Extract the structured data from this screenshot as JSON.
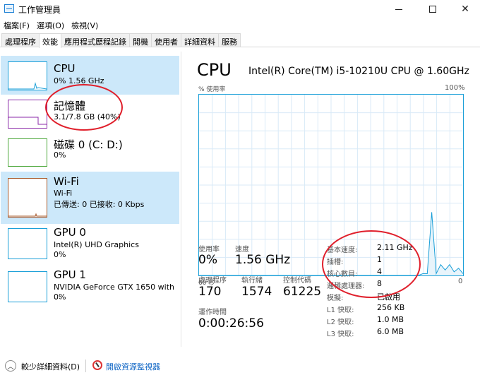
{
  "window": {
    "title": "工作管理員"
  },
  "menu": [
    "檔案(F)",
    "選項(O)",
    "檢視(V)"
  ],
  "tabs": [
    "處理程序",
    "效能",
    "應用程式歷程記錄",
    "開機",
    "使用者",
    "詳細資料",
    "服務"
  ],
  "active_tab_index": 1,
  "sidebar": {
    "items": [
      {
        "name": "CPU",
        "line1": "0% 1.56 GHz",
        "line2": "",
        "selected": true,
        "color": "#1a9fd8"
      },
      {
        "name": "記憶體",
        "line1": "3.1/7.8 GB (40%)",
        "line2": "",
        "selected": false,
        "color": "#8b2aa8"
      },
      {
        "name": "磁碟 0 (C: D:)",
        "line1": "0%",
        "line2": "",
        "selected": false,
        "color": "#4ca73a"
      },
      {
        "name": "Wi-Fi",
        "line1": "Wi-Fi",
        "line2": "已傳送: 0 已接收: 0 Kbps",
        "selected": true,
        "color": "#a6582a"
      },
      {
        "name": "GPU 0",
        "line1": "Intel(R) UHD Graphics",
        "line2": "0%",
        "selected": false,
        "color": "#1a9fd8"
      },
      {
        "name": "GPU 1",
        "line1": "NVIDIA GeForce GTX 1650 with ...",
        "line2": "0%",
        "selected": false,
        "color": "#1a9fd8"
      }
    ]
  },
  "main": {
    "title": "CPU",
    "model": "Intel(R) Core(TM) i5-10210U CPU @ 1.60GHz",
    "graph_label_left": "% 使用率",
    "graph_label_right": "100%",
    "graph_foot_left": "60 秒",
    "graph_foot_right": "0",
    "usage_percent_series": [
      0,
      0,
      0,
      0,
      0,
      0,
      0,
      0,
      0,
      0,
      0,
      0,
      0,
      0,
      0,
      0,
      0,
      0,
      0,
      0,
      0,
      0,
      0,
      0,
      0,
      0,
      0,
      0,
      0,
      0,
      0,
      0,
      0,
      0,
      0,
      0,
      0,
      0,
      0,
      0,
      0,
      0,
      0,
      0,
      0,
      0,
      0,
      0,
      0,
      0,
      1,
      1,
      35,
      1,
      6,
      3,
      6,
      2,
      4,
      1
    ],
    "stats": {
      "usage_label": "使用率",
      "usage_value": "0%",
      "speed_label": "速度",
      "speed_value": "1.56 GHz",
      "processes_label": "處理程序",
      "processes_value": "170",
      "threads_label": "執行緒",
      "threads_value": "1574",
      "handles_label": "控制代碼",
      "handles_value": "61225",
      "uptime_label": "運作時間",
      "uptime_value": "0:00:26:56"
    },
    "specs": [
      {
        "label": "基本速度:",
        "value": "2.11 GHz"
      },
      {
        "label": "插槽:",
        "value": "1"
      },
      {
        "label": "核心數目:",
        "value": "4"
      },
      {
        "label": "邏輯處理器:",
        "value": "8"
      },
      {
        "label": "模擬:",
        "value": "已啟用"
      },
      {
        "label": "L1 快取:",
        "value": "256 KB"
      },
      {
        "label": "L2 快取:",
        "value": "1.0 MB"
      },
      {
        "label": "L3 快取:",
        "value": "6.0 MB"
      }
    ]
  },
  "bottom": {
    "fewer_details": "較少詳細資料(D)",
    "resource_monitor": "開啟資源監視器"
  },
  "annotation_color": "#e0202c"
}
